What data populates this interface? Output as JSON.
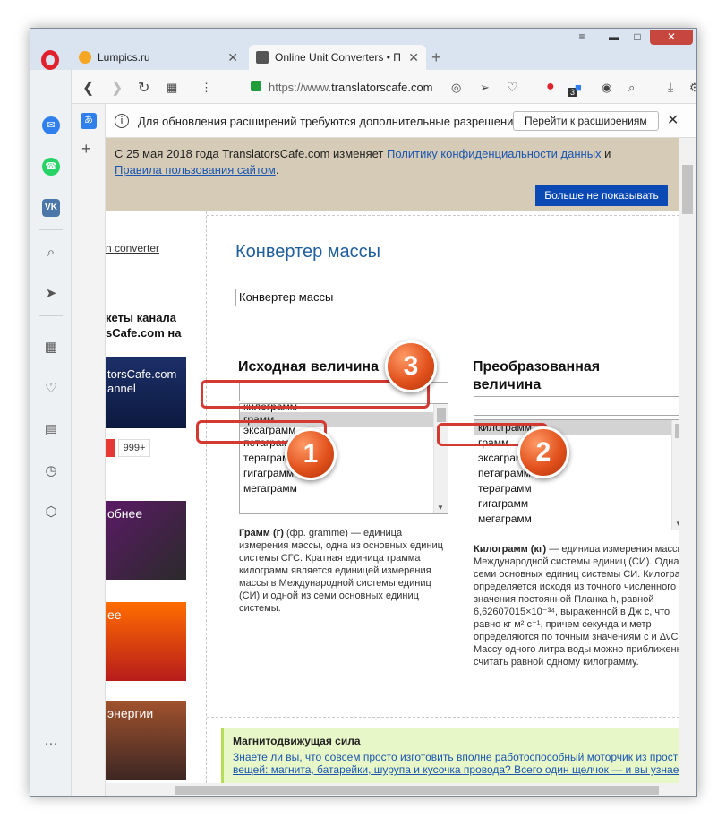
{
  "browser": {
    "tabs": [
      {
        "title": "Lumpics.ru",
        "close": "✕"
      },
      {
        "title": "Online Unit Converters • П",
        "close": "✕"
      }
    ],
    "new_tab": "+",
    "url_scheme": "https://www.",
    "url_host": "translatorscafe.com",
    "extension_badge": "3",
    "window_controls": {
      "stack": "≡",
      "minimize": "▬",
      "maximize": "□",
      "close": "✕"
    }
  },
  "sidebar": {
    "items": [
      {
        "icon": "messenger-icon"
      },
      {
        "icon": "whatsapp-icon"
      },
      {
        "icon": "vk-icon"
      },
      {
        "icon": "search-icon"
      },
      {
        "icon": "send-icon"
      },
      {
        "icon": "speed-dial-icon"
      },
      {
        "icon": "heart-icon"
      },
      {
        "icon": "news-icon"
      },
      {
        "icon": "history-icon"
      },
      {
        "icon": "extensions-icon"
      },
      {
        "icon": "more-icon"
      }
    ],
    "vk_label": "VK",
    "more_label": "···"
  },
  "infobar": {
    "message": "Для обновления расширений требуются дополнительные разрешения...",
    "button": "Перейти к расширениям",
    "close": "✕"
  },
  "cookie_banner": {
    "line1_prefix": "С 25 мая 2018 года TranslatorsCafe.com изменяет ",
    "line1_link": "Политику конфиденциальности данных",
    "line1_suffix": " и",
    "line2_link": "Правила пользования сайтом",
    "line2_suffix": ".",
    "button": "Больше не показывать"
  },
  "left_column": {
    "link": "n converter",
    "title_line1": "кеты канала",
    "title_line2": "sCafe.com на",
    "thumb1_line1": "torsCafe.com",
    "thumb1_line2": "annel",
    "subscriber_count": "999+",
    "thumb2_text": "обнее",
    "thumb3_text": "ее",
    "thumb4_text": "энергии"
  },
  "main": {
    "title": "Конвертер массы",
    "converter_select": "Конвертер массы",
    "source_header": "Исходная величина",
    "target_header": "Преобразованная величина",
    "source_units": [
      "килограмм",
      "грамм",
      "эксаграмм",
      "петаграмм",
      "тераграмм",
      "гигаграмм",
      "мегаграмм"
    ],
    "source_selected": 1,
    "target_units": [
      "килограмм",
      "грамм",
      "эксаграмм",
      "петаграмм",
      "тераграмм",
      "гигаграмм",
      "мегаграмм"
    ],
    "target_selected": 0,
    "source_desc_name": "Грамм (г)",
    "source_desc_body": " (фр. gramme) — единица измерения массы, одна из основных единиц системы СГС. Кратная единица грамма килограмм является единицей измерения массы в Международной системы единиц (СИ) и одной из семи основных единиц системы.",
    "target_desc_name": "Килограмм (кг)",
    "target_desc_body": " — единица измерения массы в Международной системы единиц (СИ). Одна из семи основных единиц системы СИ. Килограмм определяется исходя из точного численного значения постоянной Планка h, равной 6,62607015×10⁻³⁴, выраженной в Дж с, что равно кг м² с⁻¹, причем секунда и метр определяются по точным значениям c и ΔνCs. Массу одного литра воды можно приближенно считать равной одному килограмму."
  },
  "news": {
    "title": "Магнитодвижущая сила",
    "line1": "Знаете ли вы, что совсем просто изготовить вполне работоспособный моторчик из простых",
    "line2": "вещей: магнита, батарейки, шурупа и кусочка провода? Всего один щелчок — и вы узнаете"
  },
  "callouts": {
    "marker1": "1",
    "marker2": "2",
    "marker3": "3",
    "color": "#d33a32"
  }
}
